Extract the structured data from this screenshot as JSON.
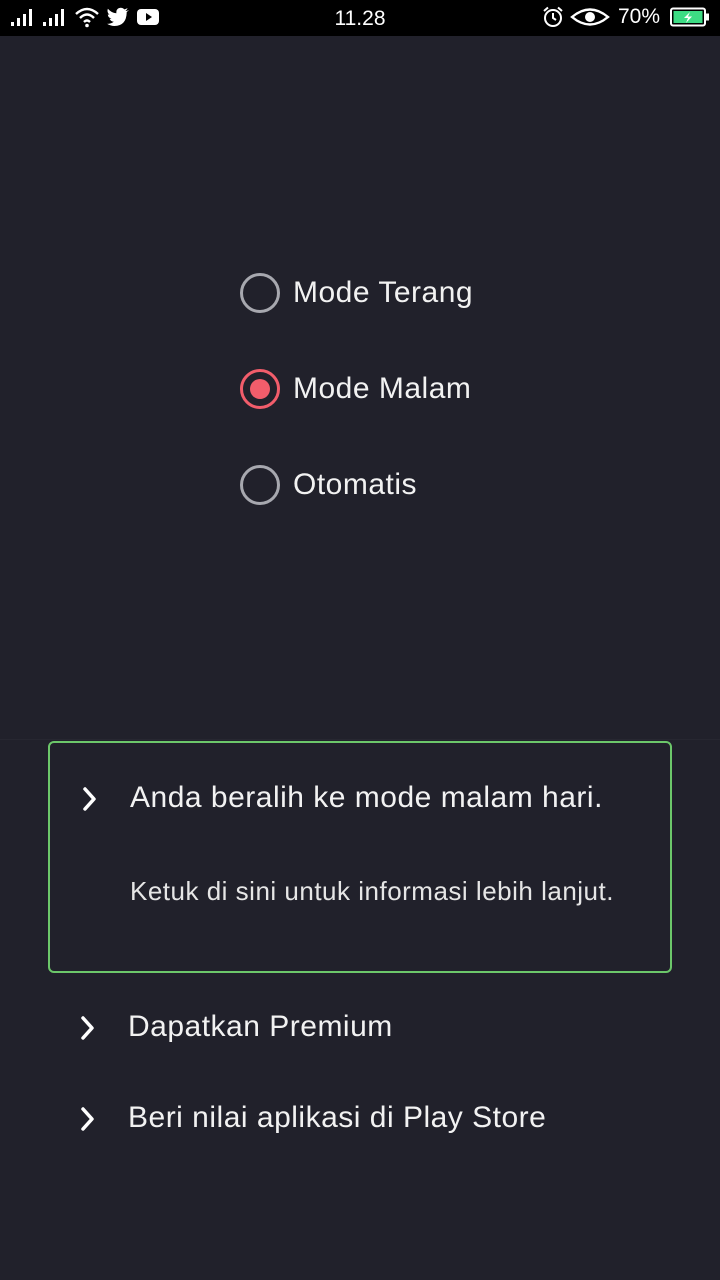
{
  "status_bar": {
    "time": "11.28",
    "battery_percent": "70%",
    "left_icons": [
      "signal-icon",
      "signal-icon",
      "wifi-icon",
      "twitter-icon",
      "youtube-icon"
    ],
    "right_icons": [
      "alarm-icon",
      "eye-icon",
      "battery-icon"
    ],
    "battery_color": "#3ddc84"
  },
  "theme_options": {
    "items": [
      {
        "label": "Mode Terang",
        "checked": false
      },
      {
        "label": "Mode Malam",
        "checked": true
      },
      {
        "label": "Otomatis",
        "checked": false
      }
    ],
    "accent_color": "#f25d6b"
  },
  "info_card": {
    "title": "Anda beralih ke mode malam hari.",
    "subtitle": "Ketuk di sini untuk informasi lebih lanjut.",
    "border_color": "#6cc76a"
  },
  "menu": {
    "premium_label": "Dapatkan Premium",
    "rate_label": "Beri nilai aplikasi di Play Store"
  }
}
